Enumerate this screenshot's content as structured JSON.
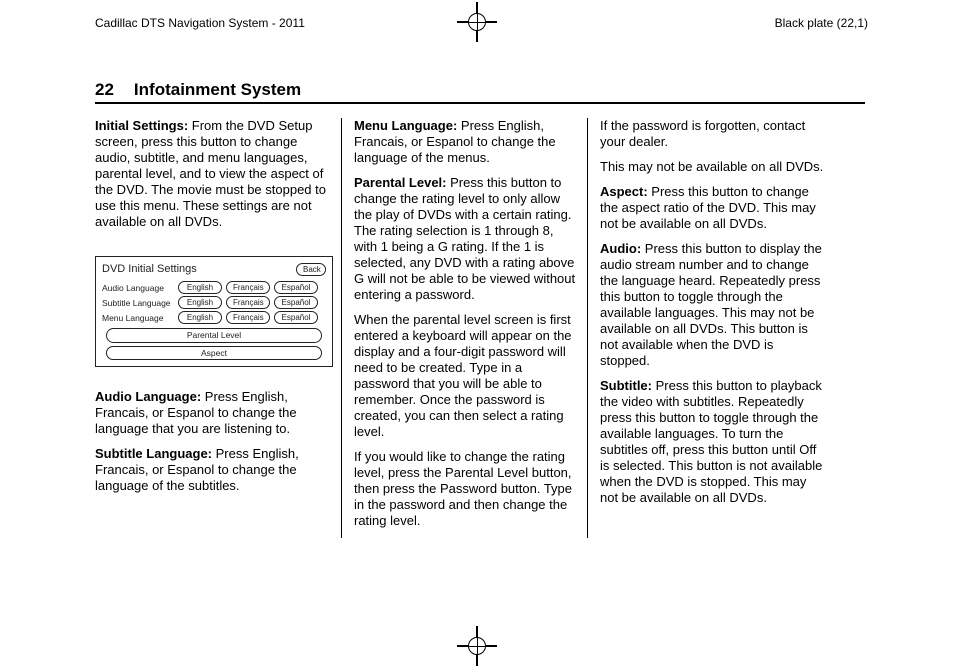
{
  "header": {
    "left": "Cadillac DTS Navigation System - 2011",
    "right": "Black plate (22,1)"
  },
  "page_number": "22",
  "section_title": "Infotainment System",
  "col1": {
    "initial_settings_label": "Initial Settings:",
    "initial_settings_body": " From the DVD Setup screen, press this button to change audio, subtitle, and menu languages, parental level, and to view the aspect of the DVD. The movie must be stopped to use this menu. These settings are not available on all DVDs.",
    "audio_lang_label": "Audio Language:",
    "audio_lang_body": " Press English, Francais, or Espanol to change the language that you are listening to.",
    "sub_lang_label": "Subtitle Language:",
    "sub_lang_body": " Press English, Francais, or Espanol to change the language of the subtitles."
  },
  "figure": {
    "title": "DVD Initial Settings",
    "back": "Back",
    "rows": [
      {
        "label": "Audio Language",
        "opts": [
          "English",
          "Français",
          "Español"
        ]
      },
      {
        "label": "Subtitle Language",
        "opts": [
          "English",
          "Français",
          "Español"
        ]
      },
      {
        "label": "Menu Language",
        "opts": [
          "English",
          "Français",
          "Español"
        ]
      }
    ],
    "parental": "Parental Level",
    "aspect": "Aspect"
  },
  "col2": {
    "menu_lang_label": "Menu Language:",
    "menu_lang_body": " Press English, Francais, or Espanol to change the language of the menus.",
    "parental_label": "Parental Level:",
    "parental_body": " Press this button to change the rating level to only allow the play of DVDs with a certain rating. The rating selection is 1 through 8, with 1 being a G rating. If the 1 is selected, any DVD with a rating above G will not be able to be viewed without entering a password.",
    "parental_p2": "When the parental level screen is first entered a keyboard will appear on the display and a four-digit password will need to be created. Type in a password that you will be able to remember. Once the password is created, you can then select a rating level.",
    "parental_p3": "If you would like to change the rating level, press the Parental Level button, then press the Password button. Type in the password and then change the rating level."
  },
  "col3": {
    "p1": "If the password is forgotten, contact your dealer.",
    "p2": "This may not be available on all DVDs.",
    "aspect_label": "Aspect:",
    "aspect_body": " Press this button to change the aspect ratio of the DVD. This may not be available on all DVDs.",
    "audio_label": "Audio:",
    "audio_body": " Press this button to display the audio stream number and to change the language heard. Repeatedly press this button to toggle through the available languages. This may not be available on all DVDs. This button is not available when the DVD is stopped.",
    "subtitle_label": "Subtitle:",
    "subtitle_body": " Press this button to playback the video with subtitles. Repeatedly press this button to toggle through the available languages. To turn the subtitles off, press this button until Off is selected. This button is not available when the DVD is stopped. This may not be available on all DVDs."
  }
}
